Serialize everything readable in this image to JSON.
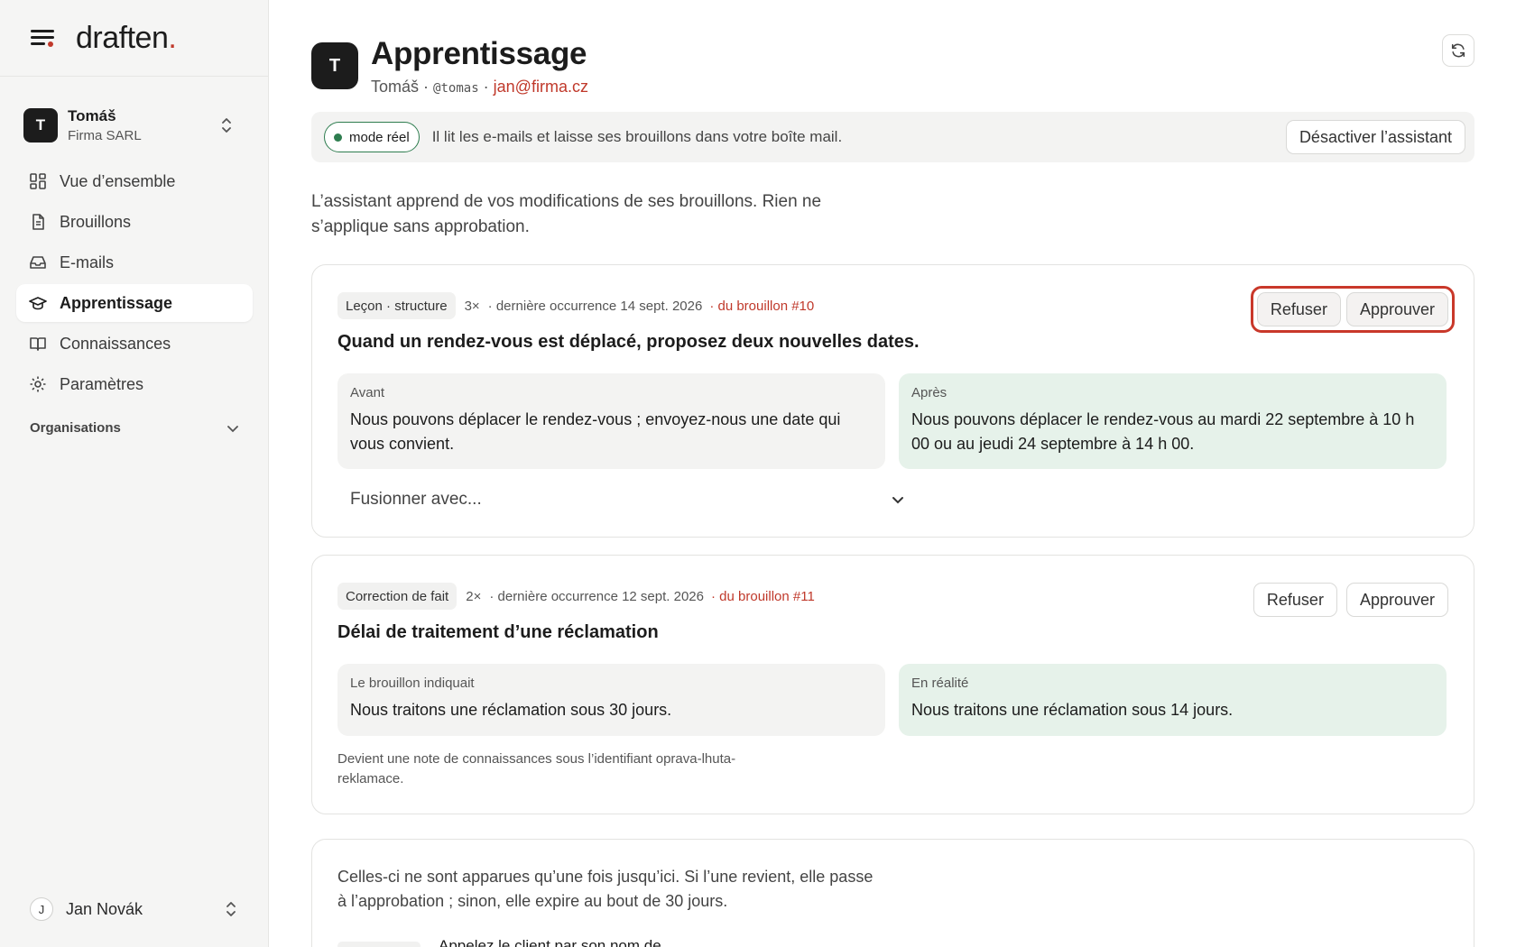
{
  "sidebar": {
    "logo_text": "draften",
    "logo_dot": ".",
    "account": {
      "initial": "T",
      "name": "Tomáš",
      "org": "Firma SARL"
    },
    "nav": [
      {
        "label": "Vue d’ensemble",
        "icon": "grid-icon"
      },
      {
        "label": "Brouillons",
        "icon": "document-icon"
      },
      {
        "label": "E-mails",
        "icon": "inbox-icon"
      },
      {
        "label": "Apprentissage",
        "icon": "graduation-cap-icon",
        "active": true
      },
      {
        "label": "Connaissances",
        "icon": "book-icon"
      },
      {
        "label": "Paramètres",
        "icon": "gear-icon"
      }
    ],
    "organisations_label": "Organisations",
    "user": {
      "initial": "J",
      "name": "Jan Novák"
    }
  },
  "header": {
    "initial": "T",
    "title": "Apprentissage",
    "name": "Tomáš",
    "separator": "·",
    "handle": "@tomas",
    "email": "jan@firma.cz"
  },
  "status": {
    "badge": "mode réel",
    "text": "Il lit les e-mails et laisse ses brouillons dans votre boîte mail.",
    "deactivate_label": "Désactiver l’assistant",
    "status_color": "#2e7d4f"
  },
  "intro": "L’assistant apprend de vos modifications de ses brouillons. Rien ne s’applique sans approbation.",
  "lessons": [
    {
      "tag": "Leçon · structure",
      "count": "3×",
      "last": "· dernière occurrence 14 sept. 2026",
      "draft_link": "· du brouillon #10",
      "title": "Quand un rendez-vous est déplacé, proposez deux nouvelles dates.",
      "refuse_label": "Refuser",
      "approve_label": "Approuver",
      "before_label": "Avant",
      "before_text": "Nous pouvons déplacer le rendez-vous ; envoyez-nous une date qui vous convient.",
      "after_label": "Après",
      "after_text": "Nous pouvons déplacer le rendez-vous au mardi 22 septembre à 10 h 00 ou au jeudi 24 septembre à 14 h 00.",
      "merge_placeholder": "Fusionner avec..."
    },
    {
      "tag": "Correction de fait",
      "count": "2×",
      "last": "· dernière occurrence 12 sept. 2026",
      "draft_link": "· du brouillon #11",
      "title": "Délai de traitement d’une réclamation",
      "refuse_label": "Refuser",
      "approve_label": "Approuver",
      "before_label": "Le brouillon indiquait",
      "before_text": "Nous traitons une réclamation sous 30 jours.",
      "after_label": "En réalité",
      "after_text": "Nous traitons une réclamation sous 14 jours.",
      "note": "Devient une note de connaissances sous l’identifiant oprava-lhuta-reklamace."
    }
  ],
  "pending": {
    "text": "Celles-ci ne sont apparues qu’une fois jusqu’ici. Si l’une revient, elle passe à l’approbation ; sinon, elle expire au bout de 30 jours.",
    "peek_text": "Appelez le client par son nom de"
  },
  "colors": {
    "accent": "#c0392b",
    "after_bg": "#e6f2ea",
    "before_bg": "#f3f3f2",
    "highlight": "#c9382a"
  }
}
